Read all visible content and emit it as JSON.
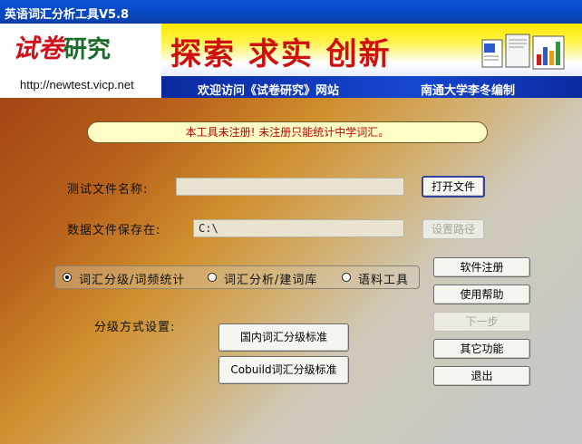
{
  "window": {
    "title": "英语词汇分析工具V5.8"
  },
  "banner": {
    "logo_part1": "试卷",
    "logo_part2": "研究",
    "url": "http://newtest.vicp.net",
    "slogan": "探索  求实  创新",
    "welcome": "欢迎访问《试卷研究》网站",
    "author": "南通大学李冬编制",
    "icon": "document-chart-icon"
  },
  "notice": {
    "text": "本工具未注册!  未注册只能统计中学词汇。",
    "color": "#c00000"
  },
  "test_file": {
    "label": "测试文件名称:",
    "value": "",
    "button": "打开文件"
  },
  "data_file": {
    "label": "数据文件保存在:",
    "value": "C:\\",
    "button": "设置路径"
  },
  "modes": {
    "options": [
      "词汇分级/词频统计",
      "词汇分析/建词库",
      "语料工具"
    ],
    "selected": "词汇分级/词频统计"
  },
  "grading": {
    "label": "分级方式设置:",
    "domestic_button": "国内词汇分级标准",
    "cobuild_button": "Cobuild词汇分级标准"
  },
  "side_buttons": {
    "register": "软件注册",
    "help": "使用帮助",
    "next": "下一步",
    "other": "其它功能",
    "exit": "退出"
  },
  "colors": {
    "titlebar": "#0a52d6",
    "banner_blue": "#1646d0",
    "slogan": "#d0100f",
    "notice_bg": "#ffffc6"
  }
}
